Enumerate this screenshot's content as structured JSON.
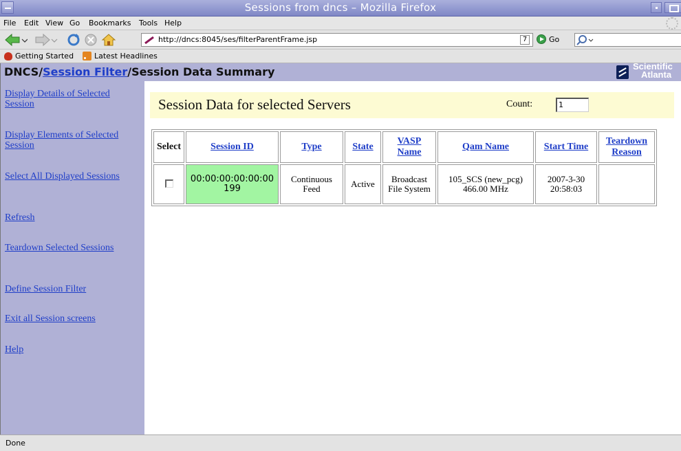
{
  "window": {
    "title": "Sessions from dncs – Mozilla Firefox"
  },
  "menu": [
    "File",
    "Edit",
    "View",
    "Go",
    "Bookmarks",
    "Tools",
    "Help"
  ],
  "toolbar": {
    "url": "http://dncs:8045/ses/filterParentFrame.jsp",
    "go_label": "Go"
  },
  "bookmarks": [
    "Getting Started",
    "Latest Headlines"
  ],
  "header": {
    "prefix": "DNCS/",
    "link": "Session Filter",
    "suffix": "/Session Data Summary",
    "logo_line1": "Scientific",
    "logo_line2": "Atlanta"
  },
  "sidebar": {
    "links": [
      "Display Details of Selected Session",
      "Display Elements of Selected Session",
      "Select All Displayed Sessions",
      "Refresh",
      "Teardown Selected Sessions",
      "Define Session Filter",
      "Exit all Session screens",
      "Help"
    ]
  },
  "main": {
    "title": "Session Data for selected Servers",
    "count_label": "Count:",
    "count_value": "1"
  },
  "table": {
    "columns": [
      "Select",
      "Session ID",
      "Type",
      "State",
      "VASP Name",
      "Qam Name",
      "Start Time",
      "Teardown Reason"
    ],
    "rows": [
      {
        "session_id": "00:00:00:00:00:00 199",
        "type": "Continuous Feed",
        "state": "Active",
        "vasp_name": "Broadcast File System",
        "qam_name": "105_SCS (new_pcg) 466.00 MHz",
        "start_time": "2007-3-30 20:58:03",
        "teardown_reason": "",
        "highlight_color": "#a2f5a2"
      }
    ]
  },
  "status": {
    "text": "Done"
  }
}
